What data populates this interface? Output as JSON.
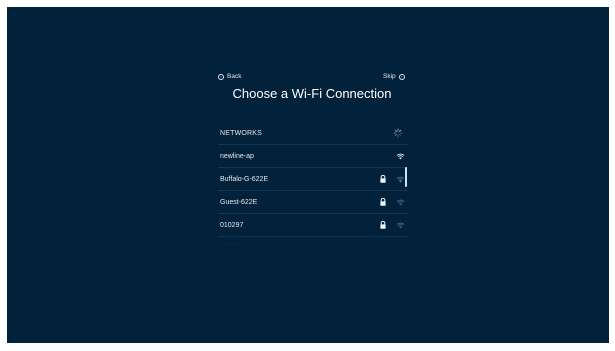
{
  "nav": {
    "back_label": "Back",
    "skip_label": "Skip"
  },
  "title": "Choose a Wi-Fi Connection",
  "networks_header": "NETWORKS",
  "networks": [
    {
      "name": "newline-ap",
      "secured": false,
      "signal": "strong"
    },
    {
      "name": "Buffalo-G-622E",
      "secured": true,
      "signal": "weak"
    },
    {
      "name": "Guest-622E",
      "secured": true,
      "signal": "weak"
    },
    {
      "name": "010297",
      "secured": true,
      "signal": "weak"
    }
  ],
  "icons": {
    "back": "back-arrow-icon",
    "skip": "skip-arrow-icon",
    "lock": "lock-icon",
    "wifi": "wifi-icon",
    "spinner": "loading-spinner-icon"
  },
  "colors": {
    "background": "#02223b",
    "text": "#e3e9ef",
    "divider": "#153650",
    "wifi_strong": "#e6edf3",
    "wifi_weak": "#4d6a82"
  }
}
